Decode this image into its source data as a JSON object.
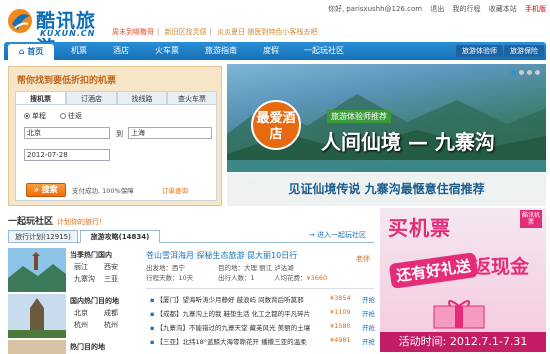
{
  "header": {
    "logo_text": "酷讯旅游",
    "logo_sub": "KUXUN.CN",
    "promo": [
      "周末到哪撒哥",
      "新旧区找灵感",
      "炎炎夏日 随医到特色小客栈去吧"
    ],
    "user": {
      "greeting": "你好,",
      "email": "parisxushh@126.com",
      "logout": "退出",
      "itinerary": "我的行程",
      "favorites": "收藏本站",
      "mobile": "手机版"
    }
  },
  "nav": {
    "items": [
      "首页",
      "机票",
      "酒店",
      "火车票",
      "旅游指南",
      "度假",
      "一起玩社区"
    ],
    "right_items": [
      "旅游体验师",
      "旅游保险"
    ]
  },
  "search": {
    "title": "帮你找到要低折扣的机票",
    "tabs": [
      "搜机票",
      "订酒店",
      "找线路",
      "查火车票"
    ],
    "trip_types": [
      "单程",
      "往返"
    ],
    "from_value": "北京",
    "to_label": "到",
    "to_value": "上海",
    "date_value": "2012-07-28",
    "submit": "搜索",
    "note": "支付成功, 100%保障",
    "order_link": "订单查询"
  },
  "banner": {
    "badge": "最爱酒店",
    "recommend": "旅游体验师推荐",
    "headline": "人间仙境 — 九寨沟",
    "subline": "见证仙境传说 九寨沟最惬意住宿推荐",
    "dots": 4,
    "active_dot": 0
  },
  "community": {
    "title": "一起玩社区",
    "subtitle": "计划你的旅行！",
    "tabs": [
      "旅行计划(12915)",
      "旅游攻略(14834)"
    ],
    "enter": "进入一起玩社区",
    "destinations": [
      {
        "title": "当季热门国内",
        "cities": [
          "丽江",
          "西安",
          "九寨沟",
          "三亚"
        ]
      },
      {
        "title": "国内热门目的地",
        "cities": [
          "北京",
          "成都",
          "杭州",
          "杭州"
        ]
      },
      {
        "title": "热门目的地",
        "cities": []
      }
    ],
    "route": {
      "head": "苍山雪洱海月  探秘生态旅游  昆大丽10日行",
      "start_lbl": "出发地：西宁",
      "dest_lbl": "目的地：大理 丽江 泸沽湖",
      "days_lbl": "行程天数：10天",
      "people_lbl": "出行人数：1",
      "cost_lbl": "人均花费：",
      "cost": "¥3660",
      "author": "老伴"
    },
    "deals": [
      {
        "text": "【厦门】望海听涛少月静好 鼓浪屿 间数背后听莫邪",
        "price": "¥3854",
        "act": "开抢"
      },
      {
        "text": "【成都】九寨沟上的我 鞋垫生活 化工之都的平凡碎片",
        "price": "¥1109",
        "act": "开抢"
      },
      {
        "text": "【九寨沟】不能错过的九寨天堂 藏羌风光 美丽的土壤",
        "price": "¥1580",
        "act": "开抢"
      },
      {
        "text": "【三亚】北纬18°蓝鲸大海零嘶花开 播撒三亚的温柔",
        "price": "¥4981",
        "act": "开抢"
      }
    ]
  },
  "ad": {
    "line1": "买机票",
    "line2": "返现金",
    "line3": "还有好礼送",
    "tag": "酷讯机票",
    "time": "活动时间: 2012.7.1-7.31"
  }
}
